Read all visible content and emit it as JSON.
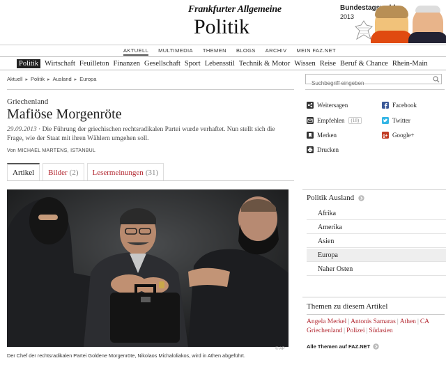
{
  "masthead": {
    "brand": "Frankfurter Allgemeine",
    "section": "Politik",
    "promo": {
      "title": "Bundestagswahl",
      "year": "2013"
    }
  },
  "topnav": [
    "AKTUELL",
    "MULTIMEDIA",
    "THEMEN",
    "BLOGS",
    "ARCHIV",
    "MEIN FAZ.NET"
  ],
  "ressorts": [
    "Politik",
    "Wirtschaft",
    "Feuilleton",
    "Finanzen",
    "Gesellschaft",
    "Sport",
    "Lebensstil",
    "Technik & Motor",
    "Wissen",
    "Reise",
    "Beruf & Chance",
    "Rhein-Main"
  ],
  "breadcrumb": [
    "Aktuell",
    "Politik",
    "Ausland",
    "Europa"
  ],
  "search": {
    "placeholder": "Suchbegriff eingeben"
  },
  "article": {
    "kicker": "Griechenland",
    "headline": "Mafiöse Morgenröte",
    "date": "29.09.2013",
    "teaser": "Die Führung der griechischen rechtsradikalen Partei wurde verhaftet. Nun stellt sich die Frage, wie der Staat mit ihren Wählern umgehen soll.",
    "byline": "Von MICHAEL MARTENS, ISTANBUL",
    "caption": "Der Chef der rechtsradikalen Partei Goldene Morgenröte, Nikolaos Michaloliakos, wird in Athen abgeführt.",
    "credit": "© AP"
  },
  "share": {
    "weitersagen": "Weitersagen",
    "facebook": "Facebook",
    "empfehlen": "Empfehlen",
    "empfehlen_count": "(18)",
    "twitter": "Twitter",
    "merken": "Merken",
    "google": "Google+",
    "drucken": "Drucken"
  },
  "tabs": {
    "artikel": "Artikel",
    "bilder": "Bilder",
    "bilder_count": "(2)",
    "leser": "Lesermeinungen",
    "leser_count": "(31)"
  },
  "sidebar": {
    "title": "Politik Ausland",
    "items": [
      "Afrika",
      "Amerika",
      "Asien",
      "Europa",
      "Naher Osten"
    ],
    "selected": "Europa",
    "themen_title": "Themen zu diesem Artikel",
    "tags": [
      "Angela Merkel",
      "Antonis Samaras",
      "Athen",
      "CA",
      "Griechenland",
      "Polizei",
      "Südasien"
    ],
    "alle": "Alle Themen auf FAZ.NET"
  },
  "colors": {
    "accent_red": "#b2262f",
    "text": "#222222",
    "rule": "#cccccc"
  }
}
